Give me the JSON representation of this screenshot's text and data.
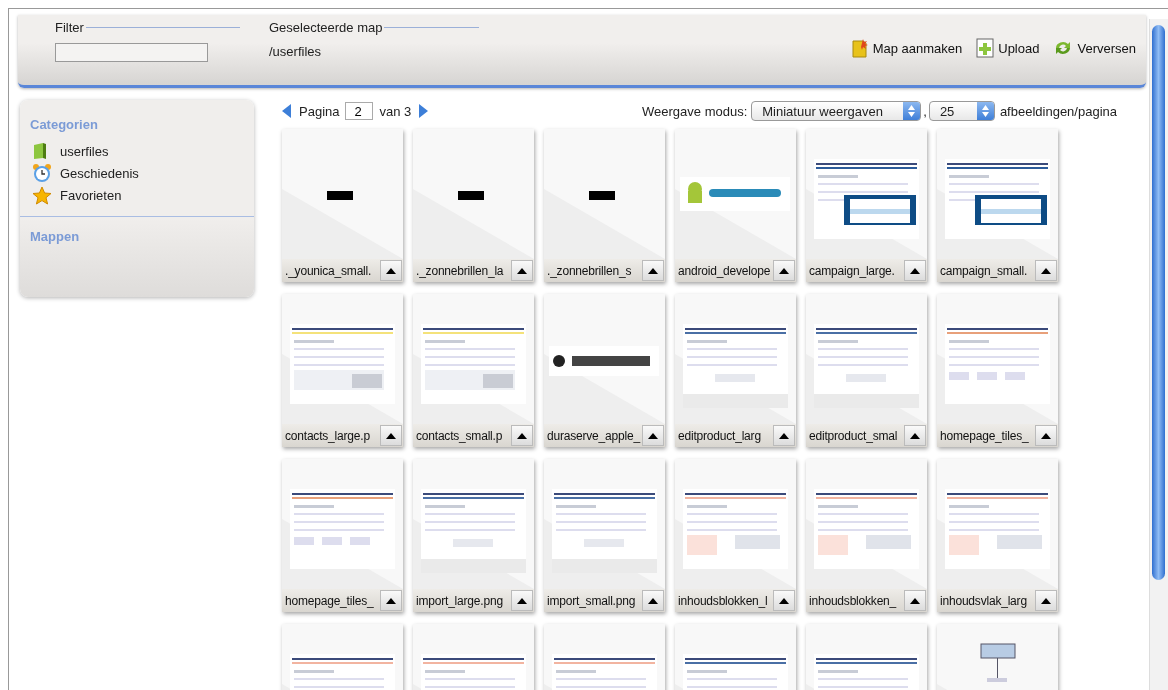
{
  "header": {
    "filter": {
      "label": "Filter"
    },
    "selected_folder": {
      "label": "Geselecteerde map",
      "path": "/userfiles"
    },
    "actions": [
      {
        "kind": "newfolder",
        "label": "Map aanmaken"
      },
      {
        "kind": "upload",
        "label": "Upload"
      },
      {
        "kind": "refresh",
        "label": "Verversen"
      }
    ]
  },
  "sidebar": {
    "categories_title": "Categorien",
    "items": [
      {
        "kind": "book",
        "label": "userfiles"
      },
      {
        "kind": "clock",
        "label": "Geschiedenis"
      },
      {
        "kind": "star",
        "label": "Favorieten"
      }
    ],
    "folders_title": "Mappen"
  },
  "pager": {
    "label": "Pagina",
    "page": "2",
    "of": "van 3"
  },
  "view": {
    "label": "Weergave modus:",
    "mode": "Miniatuur weergaven",
    "separator": ",",
    "per_page": "25",
    "per_page_label": "afbeeldingen/pagina"
  },
  "thumbnails": [
    {
      "kind": "picture",
      "name": "._younica_small."
    },
    {
      "kind": "picture",
      "name": "._zonnebrillen_la"
    },
    {
      "kind": "picture",
      "name": "._zonnebrillen_s"
    },
    {
      "kind": "picture",
      "name": "android_develope"
    },
    {
      "kind": "picture",
      "name": "campaign_large."
    },
    {
      "kind": "picture",
      "name": "campaign_small."
    },
    {
      "kind": "picture",
      "name": "contacts_large.p"
    },
    {
      "kind": "picture",
      "name": "contacts_small.p"
    },
    {
      "kind": "picture",
      "name": "duraserve_apple_"
    },
    {
      "kind": "picture",
      "name": "editproduct_larg"
    },
    {
      "kind": "picture",
      "name": "editproduct_smal"
    },
    {
      "kind": "picture",
      "name": "homepage_tiles_"
    },
    {
      "kind": "picture",
      "name": "homepage_tiles_"
    },
    {
      "kind": "picture",
      "name": "import_large.png"
    },
    {
      "kind": "picture",
      "name": "import_small.png"
    },
    {
      "kind": "picture",
      "name": "inhoudsblokken_l"
    },
    {
      "kind": "picture",
      "name": "inhoudsblokken_"
    },
    {
      "kind": "picture",
      "name": "inhoudsvlak_larg"
    },
    {
      "kind": "picture"
    },
    {
      "kind": "picture"
    },
    {
      "kind": "picture"
    },
    {
      "kind": "picture"
    },
    {
      "kind": "picture"
    },
    {
      "kind": "picture"
    }
  ]
}
